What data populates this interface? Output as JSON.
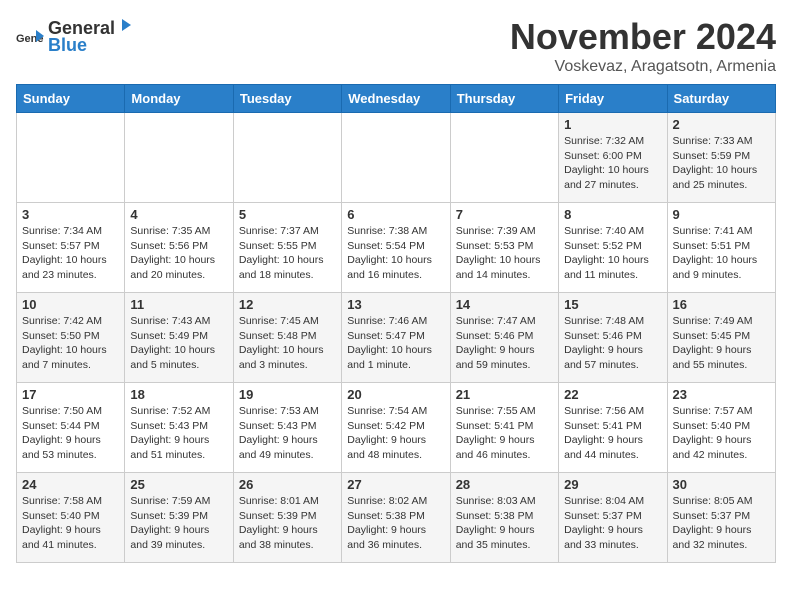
{
  "header": {
    "logo_general": "General",
    "logo_blue": "Blue",
    "month": "November 2024",
    "location": "Voskevaz, Aragatsotn, Armenia"
  },
  "weekdays": [
    "Sunday",
    "Monday",
    "Tuesday",
    "Wednesday",
    "Thursday",
    "Friday",
    "Saturday"
  ],
  "weeks": [
    [
      {
        "day": "",
        "info": ""
      },
      {
        "day": "",
        "info": ""
      },
      {
        "day": "",
        "info": ""
      },
      {
        "day": "",
        "info": ""
      },
      {
        "day": "",
        "info": ""
      },
      {
        "day": "1",
        "info": "Sunrise: 7:32 AM\nSunset: 6:00 PM\nDaylight: 10 hours and 27 minutes."
      },
      {
        "day": "2",
        "info": "Sunrise: 7:33 AM\nSunset: 5:59 PM\nDaylight: 10 hours and 25 minutes."
      }
    ],
    [
      {
        "day": "3",
        "info": "Sunrise: 7:34 AM\nSunset: 5:57 PM\nDaylight: 10 hours and 23 minutes."
      },
      {
        "day": "4",
        "info": "Sunrise: 7:35 AM\nSunset: 5:56 PM\nDaylight: 10 hours and 20 minutes."
      },
      {
        "day": "5",
        "info": "Sunrise: 7:37 AM\nSunset: 5:55 PM\nDaylight: 10 hours and 18 minutes."
      },
      {
        "day": "6",
        "info": "Sunrise: 7:38 AM\nSunset: 5:54 PM\nDaylight: 10 hours and 16 minutes."
      },
      {
        "day": "7",
        "info": "Sunrise: 7:39 AM\nSunset: 5:53 PM\nDaylight: 10 hours and 14 minutes."
      },
      {
        "day": "8",
        "info": "Sunrise: 7:40 AM\nSunset: 5:52 PM\nDaylight: 10 hours and 11 minutes."
      },
      {
        "day": "9",
        "info": "Sunrise: 7:41 AM\nSunset: 5:51 PM\nDaylight: 10 hours and 9 minutes."
      }
    ],
    [
      {
        "day": "10",
        "info": "Sunrise: 7:42 AM\nSunset: 5:50 PM\nDaylight: 10 hours and 7 minutes."
      },
      {
        "day": "11",
        "info": "Sunrise: 7:43 AM\nSunset: 5:49 PM\nDaylight: 10 hours and 5 minutes."
      },
      {
        "day": "12",
        "info": "Sunrise: 7:45 AM\nSunset: 5:48 PM\nDaylight: 10 hours and 3 minutes."
      },
      {
        "day": "13",
        "info": "Sunrise: 7:46 AM\nSunset: 5:47 PM\nDaylight: 10 hours and 1 minute."
      },
      {
        "day": "14",
        "info": "Sunrise: 7:47 AM\nSunset: 5:46 PM\nDaylight: 9 hours and 59 minutes."
      },
      {
        "day": "15",
        "info": "Sunrise: 7:48 AM\nSunset: 5:46 PM\nDaylight: 9 hours and 57 minutes."
      },
      {
        "day": "16",
        "info": "Sunrise: 7:49 AM\nSunset: 5:45 PM\nDaylight: 9 hours and 55 minutes."
      }
    ],
    [
      {
        "day": "17",
        "info": "Sunrise: 7:50 AM\nSunset: 5:44 PM\nDaylight: 9 hours and 53 minutes."
      },
      {
        "day": "18",
        "info": "Sunrise: 7:52 AM\nSunset: 5:43 PM\nDaylight: 9 hours and 51 minutes."
      },
      {
        "day": "19",
        "info": "Sunrise: 7:53 AM\nSunset: 5:43 PM\nDaylight: 9 hours and 49 minutes."
      },
      {
        "day": "20",
        "info": "Sunrise: 7:54 AM\nSunset: 5:42 PM\nDaylight: 9 hours and 48 minutes."
      },
      {
        "day": "21",
        "info": "Sunrise: 7:55 AM\nSunset: 5:41 PM\nDaylight: 9 hours and 46 minutes."
      },
      {
        "day": "22",
        "info": "Sunrise: 7:56 AM\nSunset: 5:41 PM\nDaylight: 9 hours and 44 minutes."
      },
      {
        "day": "23",
        "info": "Sunrise: 7:57 AM\nSunset: 5:40 PM\nDaylight: 9 hours and 42 minutes."
      }
    ],
    [
      {
        "day": "24",
        "info": "Sunrise: 7:58 AM\nSunset: 5:40 PM\nDaylight: 9 hours and 41 minutes."
      },
      {
        "day": "25",
        "info": "Sunrise: 7:59 AM\nSunset: 5:39 PM\nDaylight: 9 hours and 39 minutes."
      },
      {
        "day": "26",
        "info": "Sunrise: 8:01 AM\nSunset: 5:39 PM\nDaylight: 9 hours and 38 minutes."
      },
      {
        "day": "27",
        "info": "Sunrise: 8:02 AM\nSunset: 5:38 PM\nDaylight: 9 hours and 36 minutes."
      },
      {
        "day": "28",
        "info": "Sunrise: 8:03 AM\nSunset: 5:38 PM\nDaylight: 9 hours and 35 minutes."
      },
      {
        "day": "29",
        "info": "Sunrise: 8:04 AM\nSunset: 5:37 PM\nDaylight: 9 hours and 33 minutes."
      },
      {
        "day": "30",
        "info": "Sunrise: 8:05 AM\nSunset: 5:37 PM\nDaylight: 9 hours and 32 minutes."
      }
    ]
  ]
}
